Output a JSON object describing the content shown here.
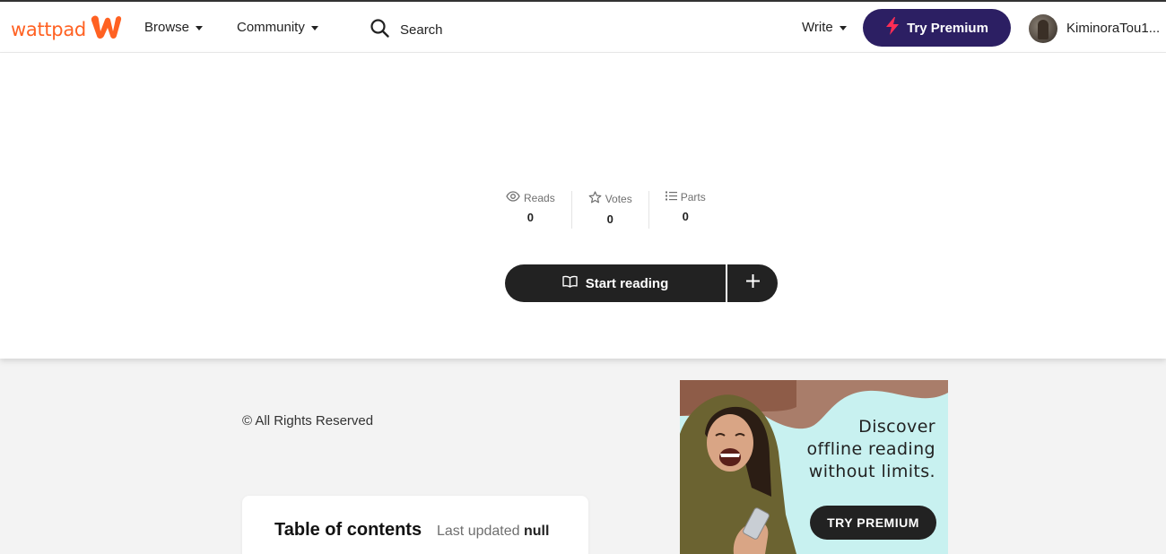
{
  "header": {
    "logo_text": "wattpad",
    "nav": {
      "browse": "Browse",
      "community": "Community",
      "search": "Search",
      "write": "Write"
    },
    "premium_button": "Try Premium",
    "username": "KiminoraTou1..."
  },
  "story": {
    "stats": [
      {
        "label": "Reads",
        "value": "0",
        "icon": "eye-icon"
      },
      {
        "label": "Votes",
        "value": "0",
        "icon": "star-icon"
      },
      {
        "label": "Parts",
        "value": "0",
        "icon": "list-icon"
      }
    ],
    "start_reading": "Start reading",
    "copyright": "© All Rights Reserved"
  },
  "toc": {
    "title": "Table of contents",
    "updated_label": "Last updated",
    "updated_value": "null"
  },
  "ad": {
    "line1": "Discover",
    "line2": "offline reading",
    "line3": "without limits.",
    "button": "TRY PREMIUM"
  },
  "colors": {
    "brand": "#ff6122",
    "premium": "#2c1f63",
    "dark_button": "#222222",
    "ad_bg": "#c8f1f0"
  }
}
